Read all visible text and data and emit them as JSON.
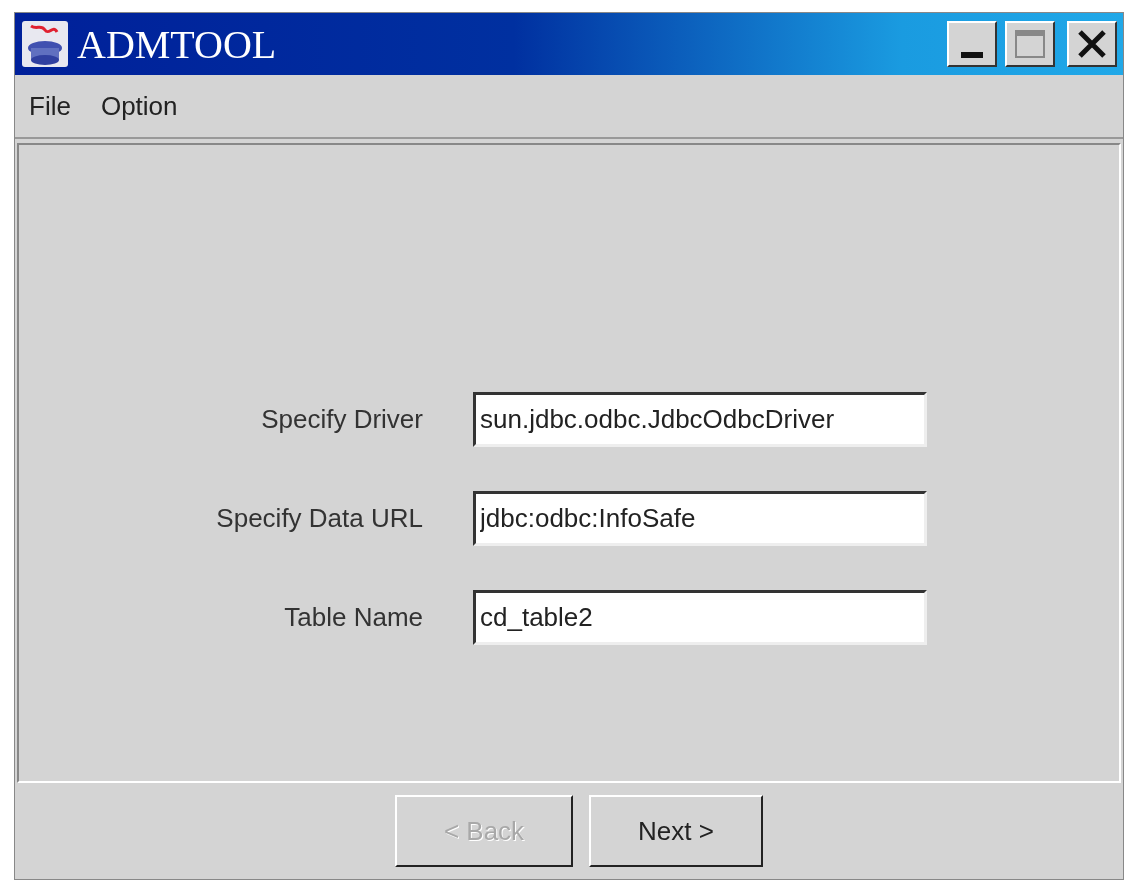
{
  "window": {
    "title": "ADMTOOL"
  },
  "menu": [
    "File",
    "Option"
  ],
  "form": [
    {
      "label": "Specify Driver",
      "value": "sun.jdbc.odbc.JdbcOdbcDriver"
    },
    {
      "label": "Specify Data URL",
      "value": "jdbc:odbc:InfoSafe"
    },
    {
      "label": "Table Name",
      "value": "cd_table2"
    }
  ],
  "buttons": [
    {
      "label": "< Back",
      "disabled": true
    },
    {
      "label": "Next >",
      "disabled": false
    }
  ]
}
